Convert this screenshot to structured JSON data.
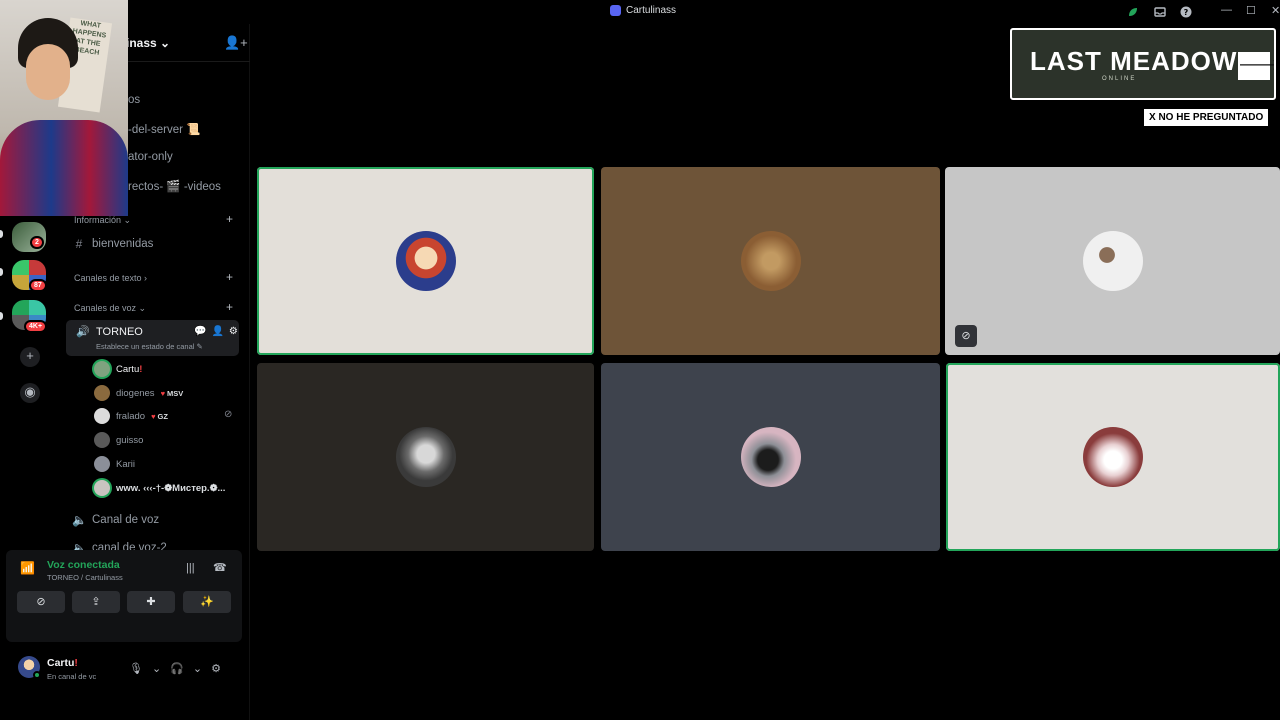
{
  "window": {
    "title": "Cartulinass"
  },
  "server": {
    "name": "inass ⌄",
    "badges": [
      "2",
      "87",
      "4K+"
    ]
  },
  "channels": {
    "partial_top": [
      {
        "label": "os"
      },
      {
        "label": "-del-server 📜"
      },
      {
        "label": "ator-only"
      },
      {
        "label": "rectos- 🎬 -videos"
      }
    ],
    "cat_info": "Información ⌄",
    "welcome": "bienvenidas",
    "cat_text": "Canales de texto ›",
    "cat_voice": "Canales de voz ⌄",
    "active_voice": {
      "name": "TORNEO",
      "status": "Establece un estado de canal ✎"
    },
    "members": [
      {
        "name": "Cartu",
        "bang": "!",
        "tag": "",
        "color": "#7fa37f"
      },
      {
        "name": "diogenes",
        "bang": "",
        "tag": "MSV",
        "color": "#8a6a3e"
      },
      {
        "name": "fralado",
        "bang": "",
        "tag": "GZ",
        "color": "#dcdcdc"
      },
      {
        "name": "guisso",
        "bang": "",
        "tag": "",
        "color": "#5a5a5a"
      },
      {
        "name": "Karii",
        "bang": "",
        "tag": "",
        "color": "#8b8f99"
      },
      {
        "name": "www. ‹‹‹-†-❁Мистер.❁...",
        "bang": "",
        "tag": "",
        "color": "#c9c4c0"
      }
    ],
    "other_voice": [
      "Canal de voz",
      "canal de voz-2"
    ]
  },
  "voice_connection": {
    "title": "Voz conectada",
    "subtitle": "TORNEO / Cartulinass"
  },
  "user": {
    "name": "Cartu",
    "bang": "!",
    "status": "En canal de vc"
  },
  "overlay": {
    "banner_title": "LAST MEADOW",
    "banner_sub": "ONLINE",
    "banner_arrow": "🡒",
    "poster_lines": [
      "WHAT",
      "HAPPENS",
      "AT THE",
      "BEACH"
    ],
    "badge": "X NO HE PREGUNTADO"
  },
  "tiles": [
    {
      "bg": "#e3dfd9",
      "speaking": true,
      "avatar": "#c8452f",
      "muted": false
    },
    {
      "bg": "#6e5438",
      "speaking": false,
      "avatar": "#8b5e34",
      "muted": false
    },
    {
      "bg": "#c6c6c6",
      "speaking": false,
      "avatar": "#f0f0f0",
      "muted": true
    },
    {
      "bg": "#2a2723",
      "speaking": false,
      "avatar": "#6b6b6b",
      "muted": false
    },
    {
      "bg": "#3e434d",
      "speaking": false,
      "avatar": "#8d8f96",
      "muted": false
    },
    {
      "bg": "#e2e0dc",
      "speaking": true,
      "avatar": "#e8d0d2",
      "muted": false
    }
  ],
  "colors": {
    "accent_green": "#23a55a",
    "badge_red": "#f23f43"
  }
}
